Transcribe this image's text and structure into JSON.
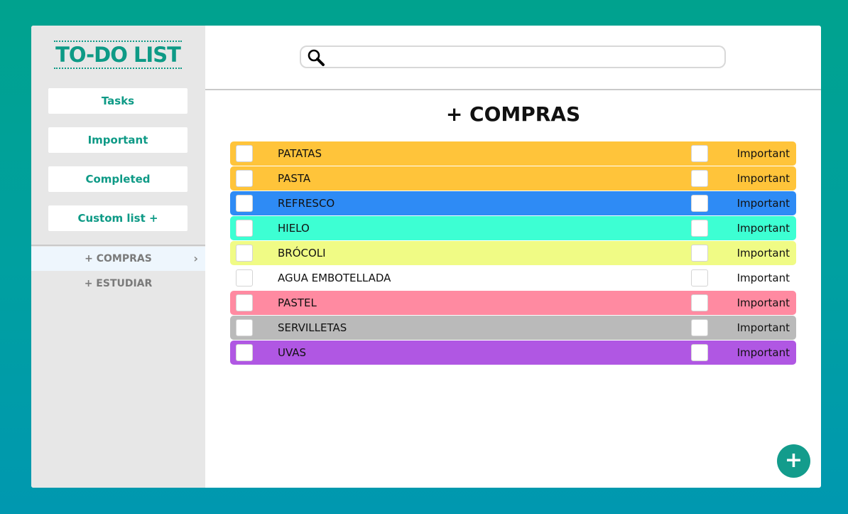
{
  "sidebar": {
    "logo": "TO-DO LIST",
    "nav": [
      {
        "label": "Tasks"
      },
      {
        "label": "Important"
      },
      {
        "label": "Completed"
      },
      {
        "label": "Custom list +"
      }
    ],
    "lists": [
      {
        "label": "+ COMPRAS",
        "active": true,
        "chevron": "›"
      },
      {
        "label": "+ ESTUDIAR",
        "active": false
      }
    ]
  },
  "search": {
    "placeholder": "",
    "value": "",
    "icon": "search-icon"
  },
  "main": {
    "title": "+ COMPRAS",
    "tasks": [
      {
        "label": "PATATAS",
        "important_label": "Important",
        "color": "#ffc43a"
      },
      {
        "label": "PASTA",
        "important_label": "Important",
        "color": "#ffc43a"
      },
      {
        "label": "REFRESCO",
        "important_label": "Important",
        "color": "#2e8bf5"
      },
      {
        "label": "HIELO",
        "important_label": "Important",
        "color": "#3dffd3"
      },
      {
        "label": "BRÓCOLI",
        "important_label": "Important",
        "color": "#f0fb85"
      },
      {
        "label": "AGUA EMBOTELLADA",
        "important_label": "Important",
        "color": "#ffffff"
      },
      {
        "label": "PASTEL",
        "important_label": "Important",
        "color": "#ff8aa1"
      },
      {
        "label": "SERVILLETAS",
        "important_label": "Important",
        "color": "#bababa"
      },
      {
        "label": "UVAS",
        "important_label": "Important",
        "color": "#b057e3"
      }
    ]
  },
  "fab": {
    "label": "+"
  },
  "colors": {
    "accent": "#0e9a86",
    "sidebar_bg": "#e7e7e7",
    "fab": "#139c8c"
  }
}
